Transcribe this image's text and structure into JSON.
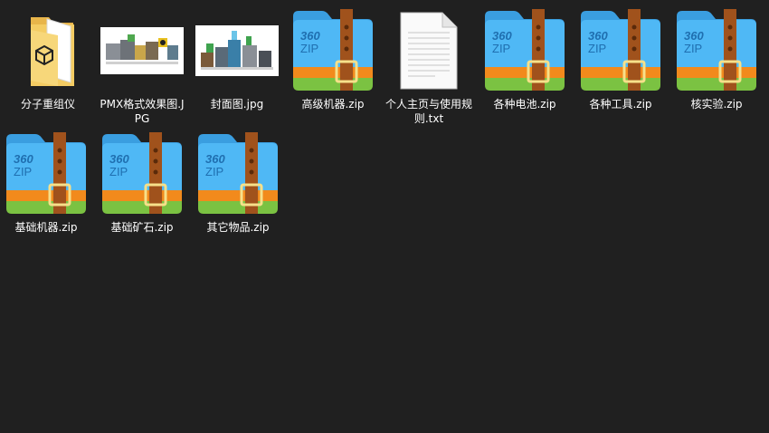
{
  "window": {
    "background": "#202020"
  },
  "files": [
    {
      "name": "分子重组仪",
      "type": "folder",
      "icon": "folder-icon"
    },
    {
      "name": "PMX格式效果图.JPG",
      "type": "image",
      "icon": "image-thumbnail"
    },
    {
      "name": "封面图.jpg",
      "type": "image",
      "icon": "image-thumbnail"
    },
    {
      "name": "高级机器.zip",
      "type": "zip",
      "icon": "zip-archive-icon"
    },
    {
      "name": "个人主页与使用规则.txt",
      "type": "text",
      "icon": "text-file-icon"
    },
    {
      "name": "各种电池.zip",
      "type": "zip",
      "icon": "zip-archive-icon"
    },
    {
      "name": "各种工具.zip",
      "type": "zip",
      "icon": "zip-archive-icon"
    },
    {
      "name": "核实验.zip",
      "type": "zip",
      "icon": "zip-archive-icon"
    },
    {
      "name": "基础机器.zip",
      "type": "zip",
      "icon": "zip-archive-icon"
    },
    {
      "name": "基础矿石.zip",
      "type": "zip",
      "icon": "zip-archive-icon"
    },
    {
      "name": "其它物品.zip",
      "type": "zip",
      "icon": "zip-archive-icon"
    }
  ],
  "zip_icon": {
    "brand": "360",
    "text": "ZIP"
  },
  "colors": {
    "zip_blue": "#4fb8f5",
    "zip_orange": "#f28a1c",
    "zip_green": "#7bc242",
    "zip_strap": "#a0521c",
    "folder_yellow": "#f4cc63"
  }
}
